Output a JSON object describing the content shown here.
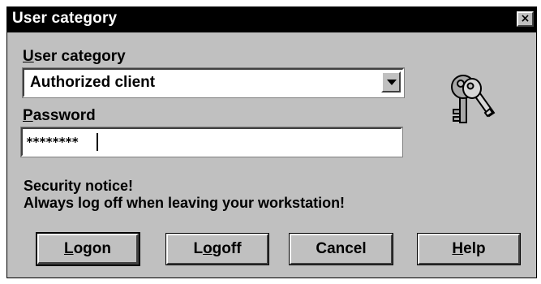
{
  "window": {
    "title": "User category",
    "close_glyph": "×"
  },
  "form": {
    "category_label_mnemonic": "U",
    "category_label_rest": "ser category",
    "category_value": "Authorized client",
    "password_label_mnemonic": "P",
    "password_label_rest": "assword",
    "password_value": "********"
  },
  "notice": {
    "line1": "Security notice!",
    "line2": "Always log off when leaving your workstation!"
  },
  "buttons": {
    "logon_mnemonic": "L",
    "logon_rest": "ogon",
    "logoff_pre": "L",
    "logoff_mnemonic": "o",
    "logoff_rest": "goff",
    "cancel": "Cancel",
    "help_mnemonic": "H",
    "help_rest": "elp"
  },
  "icons": {
    "keys": "keys-icon",
    "close": "close-icon",
    "dropdown": "chevron-down-icon"
  },
  "colors": {
    "titlebar": "#000000",
    "face": "#c0c0c0",
    "field": "#ffffff"
  }
}
